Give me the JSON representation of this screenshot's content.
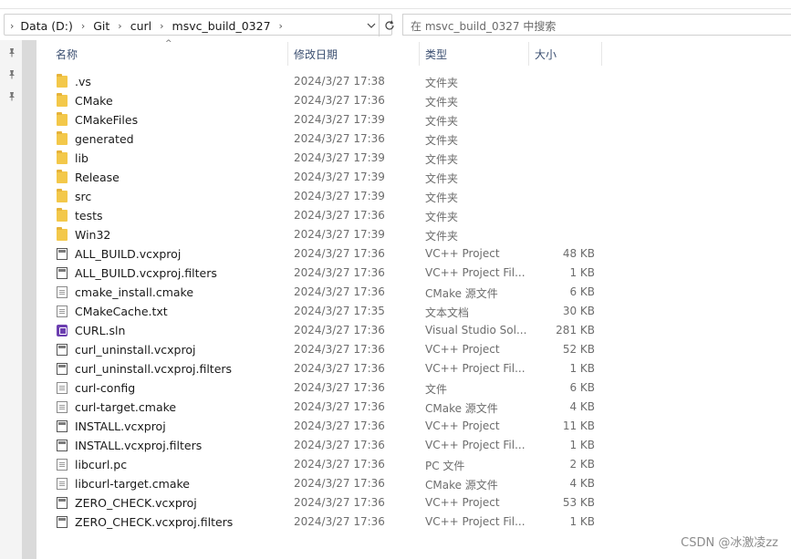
{
  "address": {
    "crumbs": [
      "Data (D:)",
      "Git",
      "curl",
      "msvc_build_0327"
    ],
    "search_placeholder": "在 msvc_build_0327 中搜索"
  },
  "columns": {
    "name": "名称",
    "date": "修改日期",
    "type": "类型",
    "size": "大小"
  },
  "files": [
    {
      "name": ".vs",
      "date": "2024/3/27 17:38",
      "type": "文件夹",
      "size": "",
      "icon": "folder"
    },
    {
      "name": "CMake",
      "date": "2024/3/27 17:36",
      "type": "文件夹",
      "size": "",
      "icon": "folder"
    },
    {
      "name": "CMakeFiles",
      "date": "2024/3/27 17:39",
      "type": "文件夹",
      "size": "",
      "icon": "folder"
    },
    {
      "name": "generated",
      "date": "2024/3/27 17:36",
      "type": "文件夹",
      "size": "",
      "icon": "folder"
    },
    {
      "name": "lib",
      "date": "2024/3/27 17:39",
      "type": "文件夹",
      "size": "",
      "icon": "folder"
    },
    {
      "name": "Release",
      "date": "2024/3/27 17:39",
      "type": "文件夹",
      "size": "",
      "icon": "folder"
    },
    {
      "name": "src",
      "date": "2024/3/27 17:39",
      "type": "文件夹",
      "size": "",
      "icon": "folder"
    },
    {
      "name": "tests",
      "date": "2024/3/27 17:36",
      "type": "文件夹",
      "size": "",
      "icon": "folder"
    },
    {
      "name": "Win32",
      "date": "2024/3/27 17:39",
      "type": "文件夹",
      "size": "",
      "icon": "folder"
    },
    {
      "name": "ALL_BUILD.vcxproj",
      "date": "2024/3/27 17:36",
      "type": "VC++ Project",
      "size": "48 KB",
      "icon": "proj"
    },
    {
      "name": "ALL_BUILD.vcxproj.filters",
      "date": "2024/3/27 17:36",
      "type": "VC++ Project Fil...",
      "size": "1 KB",
      "icon": "proj"
    },
    {
      "name": "cmake_install.cmake",
      "date": "2024/3/27 17:36",
      "type": "CMake 源文件",
      "size": "6 KB",
      "icon": "file"
    },
    {
      "name": "CMakeCache.txt",
      "date": "2024/3/27 17:35",
      "type": "文本文档",
      "size": "30 KB",
      "icon": "file"
    },
    {
      "name": "CURL.sln",
      "date": "2024/3/27 17:36",
      "type": "Visual Studio Sol...",
      "size": "281 KB",
      "icon": "sln"
    },
    {
      "name": "curl_uninstall.vcxproj",
      "date": "2024/3/27 17:36",
      "type": "VC++ Project",
      "size": "52 KB",
      "icon": "proj"
    },
    {
      "name": "curl_uninstall.vcxproj.filters",
      "date": "2024/3/27 17:36",
      "type": "VC++ Project Fil...",
      "size": "1 KB",
      "icon": "proj"
    },
    {
      "name": "curl-config",
      "date": "2024/3/27 17:36",
      "type": "文件",
      "size": "6 KB",
      "icon": "file"
    },
    {
      "name": "curl-target.cmake",
      "date": "2024/3/27 17:36",
      "type": "CMake 源文件",
      "size": "4 KB",
      "icon": "file"
    },
    {
      "name": "INSTALL.vcxproj",
      "date": "2024/3/27 17:36",
      "type": "VC++ Project",
      "size": "11 KB",
      "icon": "proj"
    },
    {
      "name": "INSTALL.vcxproj.filters",
      "date": "2024/3/27 17:36",
      "type": "VC++ Project Fil...",
      "size": "1 KB",
      "icon": "proj"
    },
    {
      "name": "libcurl.pc",
      "date": "2024/3/27 17:36",
      "type": "PC 文件",
      "size": "2 KB",
      "icon": "file"
    },
    {
      "name": "libcurl-target.cmake",
      "date": "2024/3/27 17:36",
      "type": "CMake 源文件",
      "size": "4 KB",
      "icon": "file"
    },
    {
      "name": "ZERO_CHECK.vcxproj",
      "date": "2024/3/27 17:36",
      "type": "VC++ Project",
      "size": "53 KB",
      "icon": "proj"
    },
    {
      "name": "ZERO_CHECK.vcxproj.filters",
      "date": "2024/3/27 17:36",
      "type": "VC++ Project Fil...",
      "size": "1 KB",
      "icon": "proj"
    }
  ],
  "watermark": "CSDN @冰激凌zz"
}
